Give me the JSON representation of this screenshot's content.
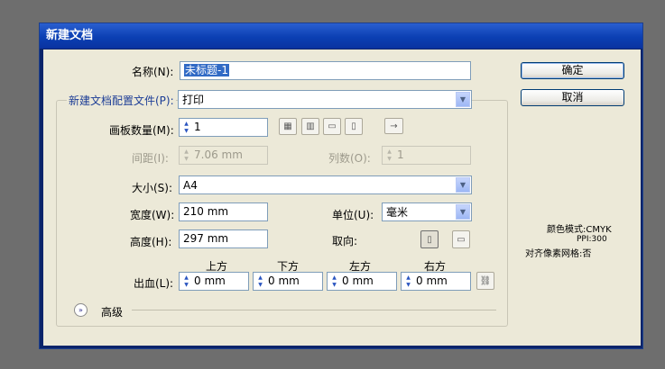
{
  "window": {
    "title": "新建文档"
  },
  "name": {
    "label": "名称(N):",
    "value": "未标题-1"
  },
  "profile": {
    "label": "新建文档配置文件(P):",
    "value": "打印"
  },
  "artboards": {
    "label": "画板数量(M):",
    "value": "1",
    "arrange_icons": [
      "grid-by-row-icon",
      "grid-by-column-icon",
      "arrange-by-row-icon",
      "arrange-by-column-icon",
      "change-layout-direction-icon"
    ]
  },
  "spacing": {
    "label": "间距(I):",
    "value": "7.06 mm"
  },
  "columns": {
    "label": "列数(O):",
    "value": "1"
  },
  "size": {
    "label": "大小(S):",
    "value": "A4"
  },
  "width": {
    "label": "宽度(W):",
    "value": "210 mm"
  },
  "units": {
    "label": "单位(U):",
    "value": "毫米"
  },
  "height": {
    "label": "高度(H):",
    "value": "297 mm"
  },
  "orientation": {
    "label": "取向:"
  },
  "bleed": {
    "label": "出血(L):",
    "headers": [
      "上方",
      "下方",
      "左方",
      "右方"
    ],
    "values": [
      "0 mm",
      "0 mm",
      "0 mm",
      "0 mm"
    ]
  },
  "advanced": {
    "label": "高级"
  },
  "buttons": {
    "ok": "确定",
    "cancel": "取消"
  },
  "info": {
    "color_mode": "颜色模式:CMYK",
    "ppi": "PPI:300",
    "pixel_align": "对齐像素网格:否"
  },
  "colors": {
    "titlebar": "#0b3fb3",
    "client": "#ece9d8",
    "background": "#6e6e6e"
  }
}
